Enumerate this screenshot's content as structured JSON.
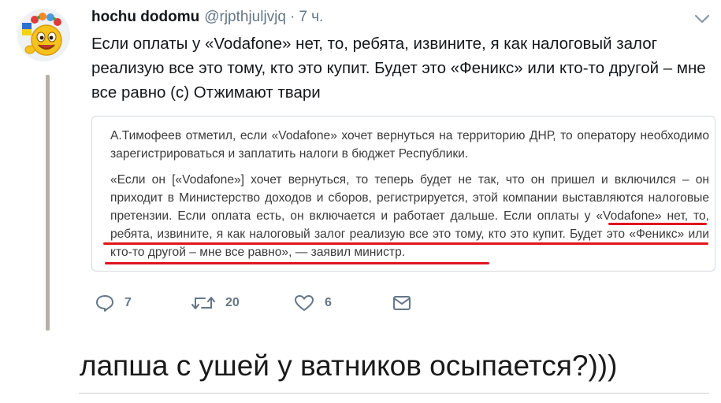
{
  "tweet": {
    "author_name": "hochu dodomu",
    "handle": "@rjpthjuljvjq",
    "separator": "·",
    "time": "7 ч.",
    "text": "Если оплаты у «Vodafone» нет, то, ребята, извините, я как налоговый залог реализую все это тому, кто это купит. Будет это «Феникс» или кто-то другой – мне все равно (с) Отжимают твари"
  },
  "quote": {
    "paragraph1": "А.Тимофеев отметил, если «Vodafone» хочет вернуться на территорию ДНР, то оператору необходимо зарегистрироваться и заплатить налоги в бюджет Республики.",
    "paragraph2": "«Если он [«Vodafone»] хочет вернуться, то теперь будет не так, что он пришел и включился – он приходит в Министерство доходов и сборов, регистрируется, этой компании выставляются налоговые претензии. Если оплата есть, он включается и работает дальше. Если оплаты у «Vodafone» нет, то, ребята, извините, я как налоговый залог реализую все это тому, кто это купит. Будет это «Феникс» или кто-то другой – мне все равно», — заявил министр."
  },
  "actions": {
    "replies": "7",
    "retweets": "20",
    "likes": "6"
  },
  "caption": "лапша с ушей у ватников осыпается?)))",
  "icons": {
    "reply": "reply-icon",
    "retweet": "retweet-icon",
    "like": "heart-icon",
    "message": "envelope-icon",
    "caret": "chevron-down-icon",
    "avatar": "smiley-avatar"
  },
  "colors": {
    "highlight_underline": "#e0141e",
    "muted_text": "#657786",
    "thread_line": "#b6b1a6"
  }
}
